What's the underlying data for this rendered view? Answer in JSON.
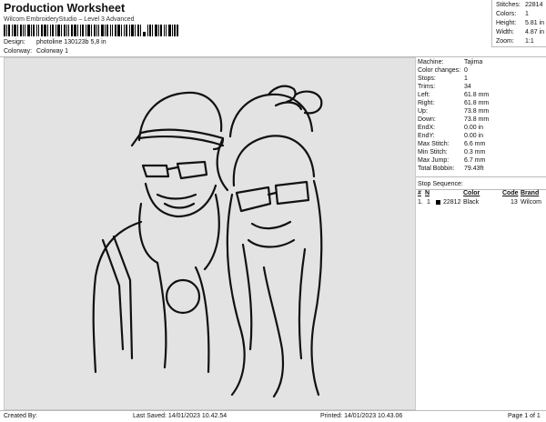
{
  "header": {
    "title": "Production Worksheet",
    "subtitle": "Wilcom EmbroideryStudio – Level 3 Advanced",
    "design_label": "Design:",
    "design_value": "photoline 130123b 5,8 in",
    "colorway_label": "Colorway:",
    "colorway_value": "Colorway 1"
  },
  "top_stats": [
    {
      "label": "Stitches:",
      "value": "22814"
    },
    {
      "label": "Colors:",
      "value": "1"
    },
    {
      "label": "Height:",
      "value": "5.81 in"
    },
    {
      "label": "Width:",
      "value": "4.87 in"
    },
    {
      "label": "Zoom:",
      "value": "1:1"
    }
  ],
  "properties": [
    {
      "label": "Machine:",
      "value": "Tajima"
    },
    {
      "label": "Color changes:",
      "value": "0"
    },
    {
      "label": "Stops:",
      "value": "1"
    },
    {
      "label": "Trims:",
      "value": "34"
    },
    {
      "label": "Left:",
      "value": "61.8 mm"
    },
    {
      "label": "Right:",
      "value": "61.8 mm"
    },
    {
      "label": "Up:",
      "value": "73.8 mm"
    },
    {
      "label": "Down:",
      "value": "73.8 mm"
    },
    {
      "label": "EndX:",
      "value": "0.00 in"
    },
    {
      "label": "EndY:",
      "value": "0.00 in"
    },
    {
      "label": "Max Stitch:",
      "value": "6.6 mm"
    },
    {
      "label": "Min Stitch:",
      "value": "0.3 mm"
    },
    {
      "label": "Max Jump:",
      "value": "6.7 mm"
    },
    {
      "label": "Total Bobbin:",
      "value": "79.43ft"
    }
  ],
  "stop_sequence": {
    "title": "Stop Sequence:",
    "headers": [
      "#",
      "N",
      "Color",
      "Code",
      "Brand"
    ],
    "rows": [
      {
        "num": "1.",
        "n": "1",
        "stitches": "22812",
        "color": "Black",
        "code": "13",
        "brand": "Wilcom"
      }
    ]
  },
  "footer": {
    "created_by": "Created By:",
    "last_saved": "Last Saved: 14/01/2023 10.42.54",
    "printed": "Printed: 14/01/2023 10.43.06",
    "page": "Page 1 of 1"
  },
  "colors": {
    "canvas_bg": "#e3e3e3",
    "thread": "#111111"
  }
}
